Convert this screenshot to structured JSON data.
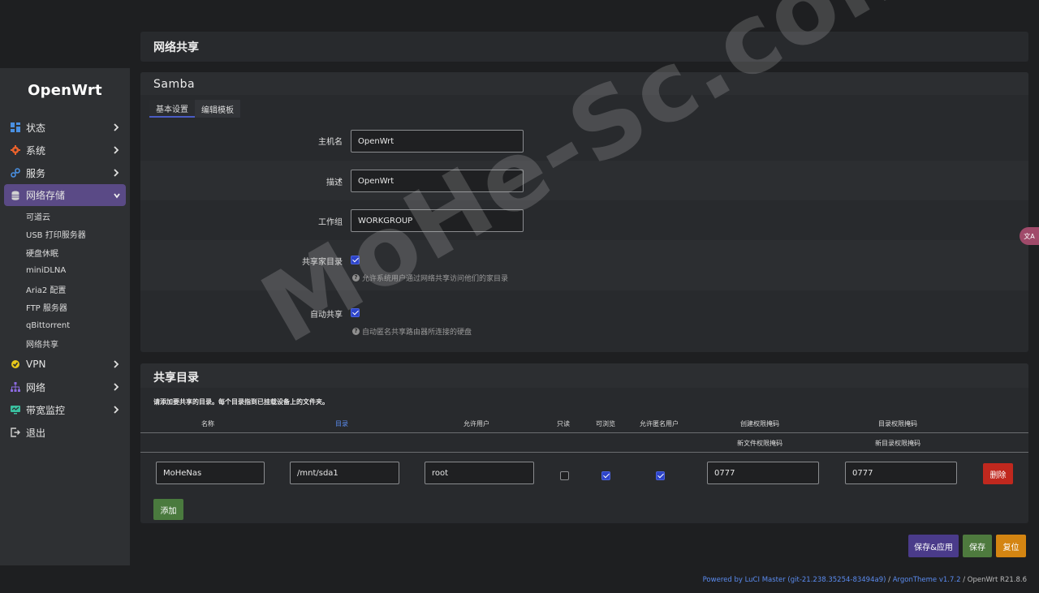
{
  "app": {
    "logo": "OpenWrt",
    "page_title": "网络共享"
  },
  "sidebar": {
    "items": [
      {
        "label": "状态",
        "icon": "dashboard-icon",
        "color": "#4a90e2"
      },
      {
        "label": "系统",
        "icon": "gear-icon",
        "color": "#e8612c"
      },
      {
        "label": "服务",
        "icon": "link-icon",
        "color": "#4a90e2"
      },
      {
        "label": "网络存储",
        "icon": "database-icon",
        "color": "#cfcfcf",
        "active": true
      },
      {
        "label": "VPN",
        "icon": "shield-icon",
        "color": "#e8c81a"
      },
      {
        "label": "网络",
        "icon": "network-icon",
        "color": "#8b6adf"
      },
      {
        "label": "带宽监控",
        "icon": "monitor-icon",
        "color": "#3ac0a0"
      },
      {
        "label": "退出",
        "icon": "logout-icon",
        "color": "#cfcfcf"
      }
    ],
    "submenu": [
      "可道云",
      "USB 打印服务器",
      "硬盘休眠",
      "miniDLNA",
      "Aria2 配置",
      "FTP 服务器",
      "qBittorrent",
      "网络共享"
    ]
  },
  "samba": {
    "title": "Samba",
    "tabs": [
      "基本设置",
      "编辑模板"
    ],
    "hostname_label": "主机名",
    "hostname_value": "OpenWrt",
    "desc_label": "描述",
    "desc_value": "OpenWrt",
    "workgroup_label": "工作组",
    "workgroup_value": "WORKGROUP",
    "homes_label": "共享家目录",
    "homes_help": "允许系统用户通过网络共享访问他们的家目录",
    "autoshare_label": "自动共享",
    "autoshare_help": "自动匿名共享路由器所连接的硬盘"
  },
  "shares": {
    "title": "共享目录",
    "description": "请添加要共享的目录。每个目录指到已挂载设备上的文件夹。",
    "headers": {
      "name": "名称",
      "path": "目录",
      "users": "允许用户",
      "readonly": "只读",
      "browseable": "可浏览",
      "guest": "允许匿名用户",
      "create_mask": "创建权限掩码",
      "dir_mask": "目录权限掩码",
      "new_file_mask": "新文件权限掩码",
      "new_dir_mask": "新目录权限掩码"
    },
    "row": {
      "name": "MoHeNas",
      "path": "/mnt/sda1",
      "users": "root",
      "readonly": false,
      "browseable": true,
      "guest": true,
      "create_mask": "0777",
      "dir_mask": "0777"
    },
    "delete_label": "删除",
    "add_label": "添加"
  },
  "actions": {
    "save_apply": "保存&应用",
    "save": "保存",
    "reset": "复位"
  },
  "footer": {
    "powered": "Powered by LuCI Master (git-21.238.35254-83494a9)",
    "sep": " / ",
    "theme": "ArgonTheme v1.7.2",
    "version": " / OpenWrt R21.8.6"
  },
  "watermark": "MoHe-Sc.com",
  "translate_badge": "文A"
}
